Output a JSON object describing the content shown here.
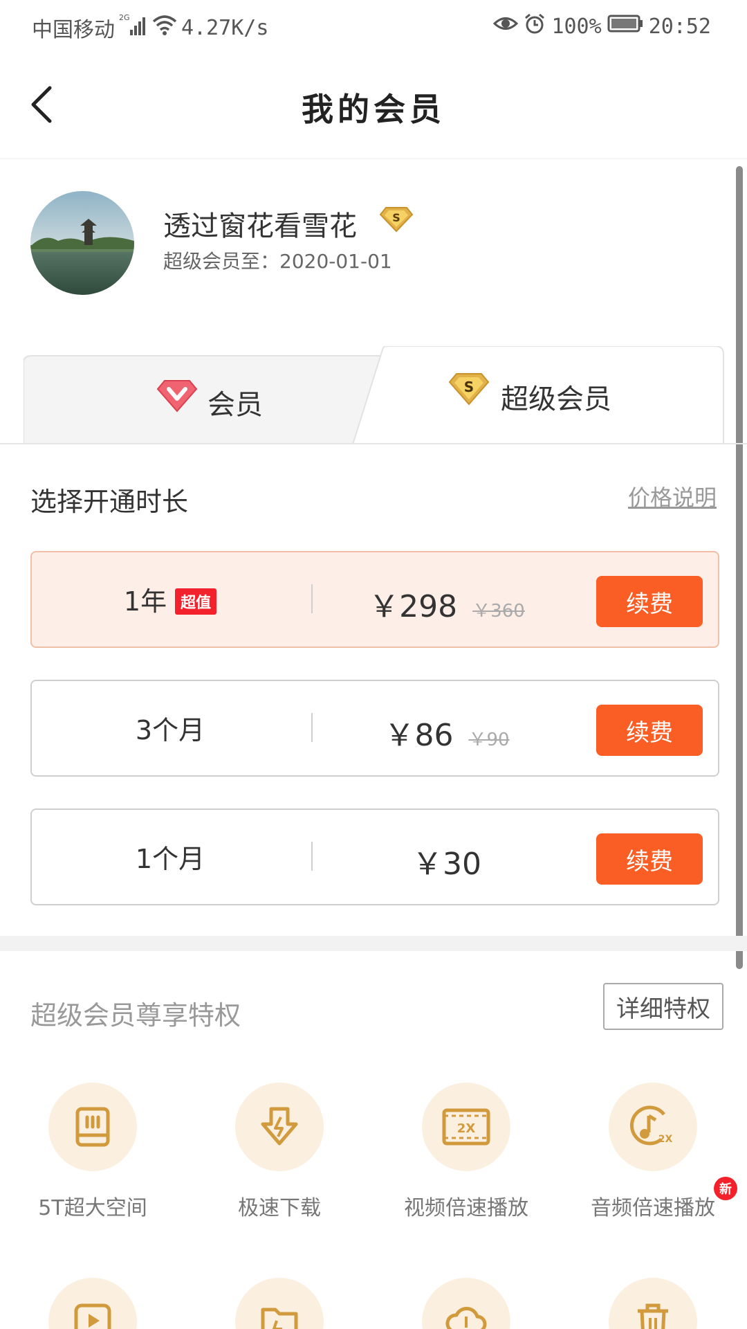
{
  "status_bar": {
    "carrier": "中国移动",
    "network": "2G",
    "speed": "4.27K/s",
    "battery": "100%",
    "time": "20:52"
  },
  "nav": {
    "title": "我的会员",
    "back_icon": "chevron-left-icon"
  },
  "profile": {
    "name": "透过窗花看雪花",
    "badge_letter": "S",
    "expiry": "超级会员至：2020-01-01"
  },
  "tabs": [
    {
      "label": "会员",
      "icon": "heart-gem-icon",
      "active": false
    },
    {
      "label": "超级会员",
      "icon": "s-gem-icon",
      "active": true
    }
  ],
  "duration_section": {
    "title": "选择开通时长",
    "price_note": "价格说明"
  },
  "plans": [
    {
      "duration": "1年",
      "badge": "超值",
      "price": "￥298",
      "old_price": "￥360",
      "button": "续费",
      "selected": true
    },
    {
      "duration": "3个月",
      "badge": "",
      "price": "￥86",
      "old_price": "￥90",
      "button": "续费",
      "selected": false
    },
    {
      "duration": "1个月",
      "badge": "",
      "price": "￥30",
      "old_price": "",
      "button": "续费",
      "selected": false
    }
  ],
  "privileges": {
    "title": "超级会员尊享特权",
    "detail_button": "详细特权",
    "items": [
      {
        "label": "5T超大空间",
        "icon": "storage-icon"
      },
      {
        "label": "极速下载",
        "icon": "fast-download-icon"
      },
      {
        "label": "视频倍速播放",
        "icon": "video-speed-icon"
      },
      {
        "label": "音频倍速播放",
        "icon": "audio-speed-icon",
        "new_badge": "新"
      }
    ]
  },
  "colors": {
    "accent": "#fb5e25",
    "gold": "#d19a3c",
    "selected_bg": "#fdeee8",
    "badge_red": "#f3212b"
  }
}
